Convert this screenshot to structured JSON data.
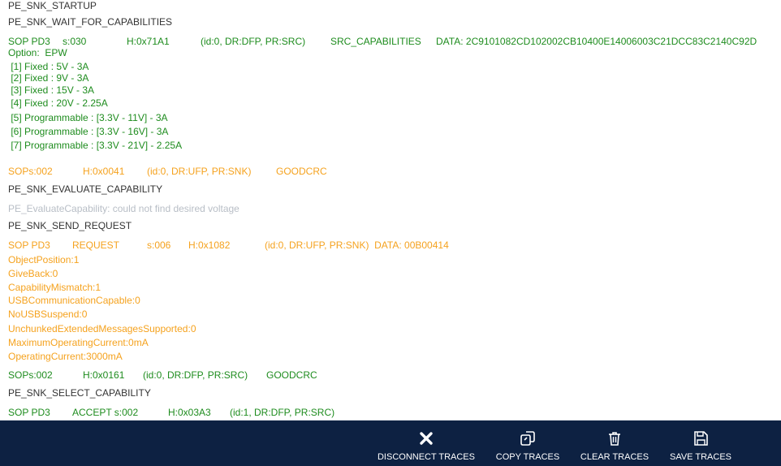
{
  "log": {
    "l0": "PE_SNK_STARTUP",
    "l1": "PE_SNK_WAIT_FOR_CAPABILITIES",
    "m1": {
      "sop": "SOP PD3",
      "s": "s:030",
      "h": "H:0x71A1",
      "id": "(id:0, DR:DFP, PR:SRC)",
      "type": "SRC_CAPABILITIES",
      "data": "DATA: 2C9101082CD102002CB10400E14006003C21DCC83C2140C92D"
    },
    "caps": [
      "Option:  EPW",
      " [1] Fixed : 5V - 3A",
      " [2] Fixed : 9V - 3A",
      " [3] Fixed : 15V - 3A",
      " [4] Fixed : 20V - 2.25A",
      " [5] Programmable : [3.3V - 11V] - 3A",
      " [6] Programmable : [3.3V - 16V] - 3A",
      " [7] Programmable : [3.3V - 21V] - 2.25A"
    ],
    "m2": {
      "sop": "SOPs:002",
      "h": "H:0x0041",
      "id": "(id:0, DR:UFP, PR:SNK)",
      "type": "GOODCRC"
    },
    "l2": "PE_SNK_EVALUATE_CAPABILITY",
    "l3": "PE_EvaluateCapability: could not find desired voltage",
    "l4": "PE_SNK_SEND_REQUEST",
    "m3": {
      "sop": "SOP PD3",
      "type": "REQUEST",
      "s": "s:006",
      "h": "H:0x1082",
      "id": "(id:0, DR:UFP, PR:SNK)  DATA: 00B00414"
    },
    "req": [
      "ObjectPosition:1",
      "GiveBack:0",
      "CapabilityMismatch:1",
      "USBCommunicationCapable:0",
      "NoUSBSuspend:0",
      "UnchunkedExtendedMessagesSupported:0",
      "MaximumOperatingCurrent:0mA",
      "OperatingCurrent:3000mA"
    ],
    "m4": {
      "sop": "SOPs:002",
      "h": "H:0x0161",
      "id": "(id:0, DR:DFP, PR:SRC)",
      "type": "GOODCRC"
    },
    "l5": "PE_SNK_SELECT_CAPABILITY",
    "m5": {
      "sop": "SOP PD3",
      "type": "ACCEPT s:002",
      "h": "H:0x03A3",
      "id": "(id:1, DR:DFP, PR:SRC)"
    }
  },
  "toolbar": {
    "disconnect": {
      "label": "DISCONNECT TRACES",
      "icon": "close-icon"
    },
    "copy": {
      "label": "COPY TRACES",
      "icon": "copy-icon"
    },
    "clear": {
      "label": "CLEAR TRACES",
      "icon": "trash-icon"
    },
    "save": {
      "label": "SAVE TRACES",
      "icon": "floppy-disk-icon"
    }
  },
  "colors": {
    "state": "#333333",
    "source_message": "#1e8c1e",
    "sink_message": "#f5a21e",
    "info": "#b8bec6",
    "toolbar_bg": "#0d2142"
  }
}
